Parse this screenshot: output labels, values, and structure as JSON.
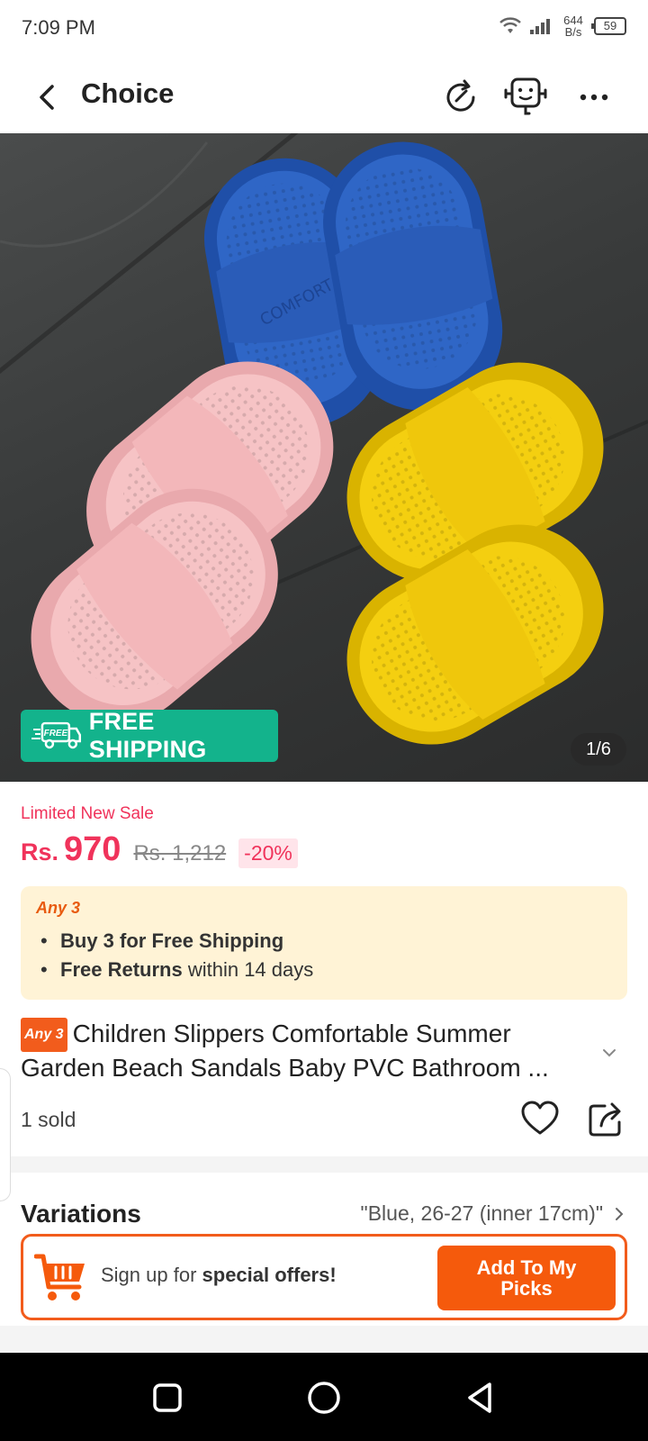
{
  "status_bar": {
    "time": "7:09 PM",
    "speed_value": "644",
    "speed_unit": "B/s",
    "battery": "59"
  },
  "header": {
    "title": "Choice"
  },
  "hero": {
    "badge": "FREE SHIPPING",
    "badge_truck_text": "FREE",
    "counter": "1/6",
    "comfort_text": "COMFORT"
  },
  "price": {
    "sale_label": "Limited New Sale",
    "currency": "Rs.",
    "current": "970",
    "original": "Rs. 1,212",
    "discount": "-20%"
  },
  "promo": {
    "tag": "Any 3",
    "line1": "Buy 3 for  Free Shipping",
    "line2_bold": "Free Returns",
    "line2_rest": " within 14 days"
  },
  "product": {
    "tag": "Any 3",
    "title": "Children Slippers Comfortable Summer Garden Beach Sandals Baby PVC Bathroom ...",
    "sold": "1 sold"
  },
  "variations": {
    "label": "Variations",
    "value": "\"Blue, 26-27 (inner 17cm)\""
  },
  "signup": {
    "text_prefix": "Sign up for ",
    "text_bold": "special offers!",
    "button": "Add To My Picks"
  },
  "colors": {
    "accent": "#f55a0c",
    "price": "#f0335b",
    "shipping": "#13b38c",
    "promo_bg": "#fff3d6"
  }
}
